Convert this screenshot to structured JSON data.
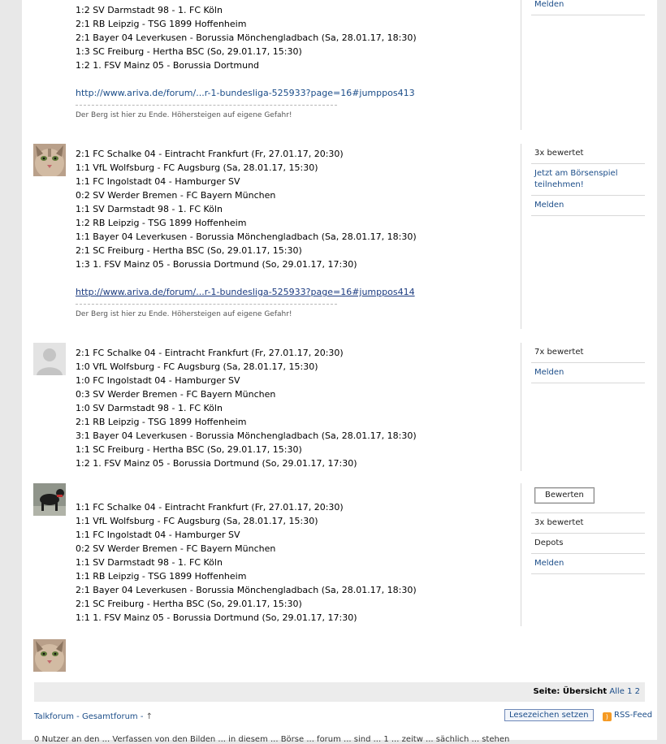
{
  "post1": {
    "lines": [
      "1:2 SV Darmstadt 98 - 1. FC Köln",
      "2:1 RB Leipzig - TSG 1899 Hoffenheim",
      "2:1 Bayer 04 Leverkusen - Borussia Mönchengladbach (Sa, 28.01.17, 18:30)",
      "1:3 SC Freiburg - Hertha BSC (So, 29.01.17, 15:30)",
      "1:2 1. FSV Mainz 05 - Borussia Dortmund"
    ],
    "link": "http://www.ariva.de/forum/...r-1-bundesliga-525933?page=16#jumppos413",
    "signature": "Der Berg ist hier zu Ende. Höhersteigen auf eigene Gefahr!",
    "side": [
      "Melden"
    ]
  },
  "post2": {
    "lines": [
      "2:1 FC Schalke 04 - Eintracht Frankfurt (Fr, 27.01.17, 20:30)",
      "1:1 VfL Wolfsburg - FC Augsburg (Sa, 28.01.17, 15:30)",
      "1:1 FC Ingolstadt 04 - Hamburger SV",
      "0:2 SV Werder Bremen - FC Bayern München",
      "1:1 SV Darmstadt 98 - 1. FC Köln",
      "1:2 RB Leipzig - TSG 1899 Hoffenheim",
      "1:1 Bayer 04 Leverkusen - Borussia Mönchengladbach (Sa, 28.01.17, 18:30)",
      "2:1 SC Freiburg - Hertha BSC (So, 29.01.17, 15:30)",
      "1:3 1. FSV Mainz 05 - Borussia Dortmund (So, 29.01.17, 17:30)"
    ],
    "link": "http://www.ariva.de/forum/...r-1-bundesliga-525933?page=16#jumppos414",
    "signature": "Der Berg ist hier zu Ende. Höhersteigen auf eigene Gefahr!",
    "rating": "3x bewertet",
    "boerse": "Jetzt am Börsenspiel teilnehmen!",
    "melden": "Melden"
  },
  "post3": {
    "lines": [
      "2:1 FC Schalke 04 - Eintracht Frankfurt (Fr, 27.01.17, 20:30)",
      "1:0 VfL Wolfsburg - FC Augsburg (Sa, 28.01.17, 15:30)",
      "1:0 FC Ingolstadt 04 - Hamburger SV",
      "0:3 SV Werder Bremen - FC Bayern München",
      "1:0 SV Darmstadt 98 - 1. FC Köln",
      "2:1 RB Leipzig - TSG 1899 Hoffenheim",
      "3:1 Bayer 04 Leverkusen - Borussia Mönchengladbach (Sa, 28.01.17, 18:30)",
      "1:1 SC Freiburg - Hertha BSC (So, 29.01.17, 15:30)",
      "1:2 1. FSV Mainz 05 - Borussia Dortmund (So, 29.01.17, 17:30)"
    ],
    "rating": "7x bewertet",
    "melden": "Melden"
  },
  "post4": {
    "lines": [
      "1:1 FC Schalke 04 - Eintracht Frankfurt (Fr, 27.01.17, 20:30)",
      "1:1 VfL Wolfsburg - FC Augsburg (Sa, 28.01.17, 15:30)",
      "1:1 FC Ingolstadt 04 - Hamburger SV",
      "0:2 SV Werder Bremen - FC Bayern München",
      "1:1 SV Darmstadt 98 - 1. FC Köln",
      "1:1 RB Leipzig - TSG 1899 Hoffenheim",
      "2:1 Bayer 04 Leverkusen - Borussia Mönchengladbach (Sa, 28.01.17, 18:30)",
      "2:1 SC Freiburg - Hertha BSC (So, 29.01.17, 15:30)",
      "1:1 1. FSV Mainz 05 - Borussia Dortmund (So, 29.01.17, 17:30)"
    ],
    "bewerten": "Bewerten",
    "rating": "3x bewertet",
    "depots": "Depots",
    "melden": "Melden"
  },
  "pager": {
    "label": "Seite:",
    "overview": "Übersicht",
    "all": "Alle",
    "p1": "1",
    "p2": "2"
  },
  "footer": {
    "breadcrumb": "Talkforum - Gesamtforum -",
    "up_arrow": "↑",
    "bookmark": "Lesezeichen setzen",
    "rss": "RSS-Feed",
    "cutoff_text": "0 Nutzer an den ... Verfassen von den Bilden ... in diesem ... Börse ... forum ... sind ... 1 ... zeitw ... sächlich ... stehen"
  }
}
